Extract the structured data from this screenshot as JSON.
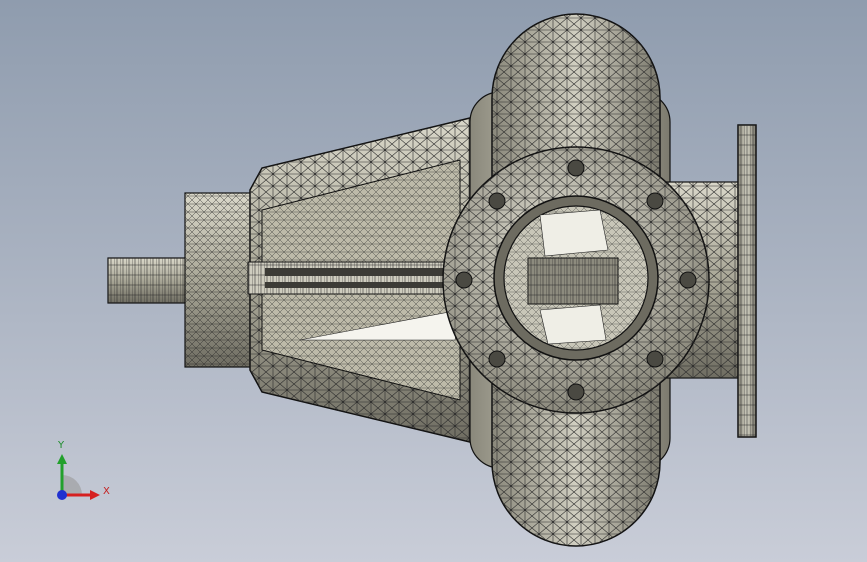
{
  "viewport": {
    "background_top": "#8f9cae",
    "background_bottom": "#c9cdd8",
    "render_mode": "wireframe-shaded"
  },
  "triad": {
    "x_label": "X",
    "y_label": "Y",
    "x_color": "#d62020",
    "y_color": "#22a02c",
    "z_color": "#2030d0"
  }
}
